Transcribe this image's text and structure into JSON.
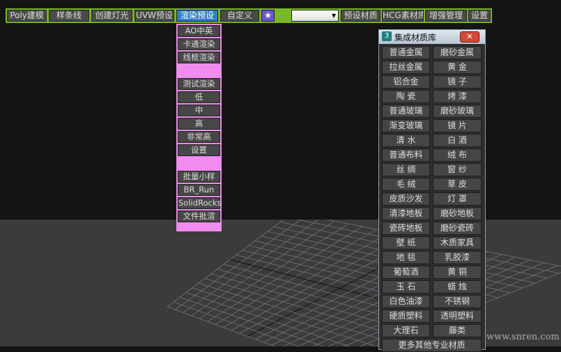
{
  "toolbar": {
    "items": [
      "Poly建模",
      "样条线",
      "创建灯光",
      "UVW预设",
      "渲染预设",
      "自定义",
      "★",
      "",
      "预设材质",
      "HCG素材库",
      "增强管理",
      "设置"
    ],
    "dropdown_arrow": "▾"
  },
  "render_menu": {
    "group1": [
      "AO中英",
      "卡通渲染",
      "线框渲染"
    ],
    "group2": [
      "测试渲染",
      "低",
      "中",
      "高",
      "非常高",
      "设置"
    ],
    "group3": [
      "批量小样",
      "BR_Run",
      "SolidRocks",
      "文件批渲"
    ]
  },
  "material_panel": {
    "title": "集成材质库",
    "close": "✕",
    "buttons": [
      [
        "普通金属",
        "磨砂金属"
      ],
      [
        "拉丝金属",
        "黄 金"
      ],
      [
        "铝合金",
        "镜 子"
      ],
      [
        "陶 瓷",
        "烤 漆"
      ],
      [
        "普通玻璃",
        "磨砂玻璃"
      ],
      [
        "渐变玻璃",
        "镜 片"
      ],
      [
        "清 水",
        "白 酒"
      ],
      [
        "普通布料",
        "绒 布"
      ],
      [
        "丝 绸",
        "窗 纱"
      ],
      [
        "毛 绒",
        "草 皮"
      ],
      [
        "皮质沙发",
        "灯 罩"
      ],
      [
        "清漆地板",
        "磨砂地板"
      ],
      [
        "瓷砖地板",
        "磨砂瓷砖"
      ],
      [
        "壁 纸",
        "木质家具"
      ],
      [
        "地 毯",
        "乳胶漆"
      ],
      [
        "葡萄酒",
        "黄 铜"
      ],
      [
        "玉 石",
        "蜡 烛"
      ],
      [
        "白色油漆",
        "不锈钢"
      ],
      [
        "硬质塑料",
        "透明塑料"
      ],
      [
        "大理石",
        "藤类"
      ]
    ],
    "more": "更多其他专业材质"
  },
  "watermark": "www.snren.com"
}
